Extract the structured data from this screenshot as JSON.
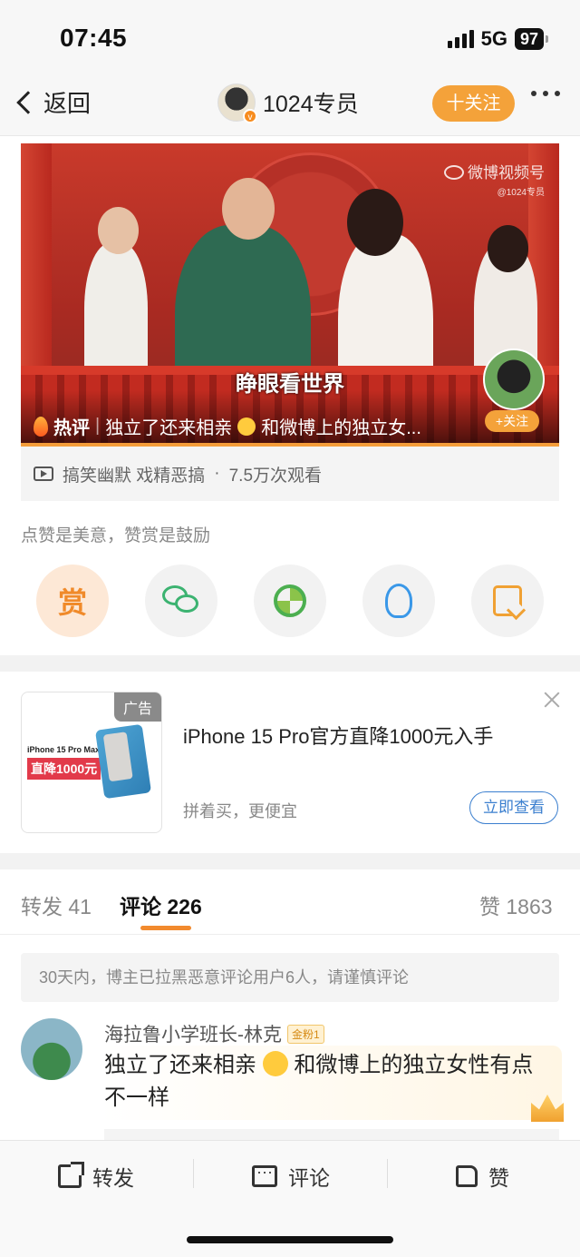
{
  "status_bar": {
    "time": "07:45",
    "network": "5G",
    "battery": "97"
  },
  "nav": {
    "back_label": "返回",
    "username": "1024专员",
    "follow_label": "十关注",
    "verified_badge": "v"
  },
  "video": {
    "watermark": "微博视频号",
    "watermark_sub": "@1024专员",
    "subtitle": "睁眼看世界",
    "hot_label": "热评",
    "hot_separator": "|",
    "hot_text_before_emoji": "独立了还来相亲",
    "hot_text_after_emoji": "和微博上的独立女...",
    "follow_label": "+关注",
    "progress": 1.0
  },
  "video_meta": {
    "category": "搞笑幽默 戏精恶搞",
    "separator": "·",
    "views": "7.5万次观看"
  },
  "share": {
    "note": "点赞是美意，赞赏是鼓励",
    "reward_label": "赏",
    "buttons": [
      "wechat-icon",
      "moments-icon",
      "qq-icon",
      "save-image-icon"
    ]
  },
  "ad": {
    "badge": "广告",
    "product_name": "iPhone 15 Pro Max",
    "price_text": "直降1000元",
    "title": "iPhone 15 Pro官方直降1000元入手",
    "subtitle": "拼着买，更便宜",
    "cta": "立即查看"
  },
  "tabs": [
    {
      "label": "转发",
      "count": "41"
    },
    {
      "label": "评论",
      "count": "226"
    },
    {
      "label": "赞",
      "count": "1863"
    }
  ],
  "notice": "30天内，博主已拉黑恶意评论用户6人，请谨慎评论",
  "comment": {
    "author": "海拉鲁小学班长-林克",
    "fan_badge": "金粉1",
    "text_before_emoji": "独立了还来相亲",
    "text_after_emoji": "和微博上的独立女性有点不一样"
  },
  "bottom_bar": {
    "repost": "转发",
    "comment": "评论",
    "like": "赞"
  },
  "colors": {
    "accent": "#f4a23a",
    "link": "#3b7fcf",
    "tab_indicator": "#f28a2e"
  }
}
